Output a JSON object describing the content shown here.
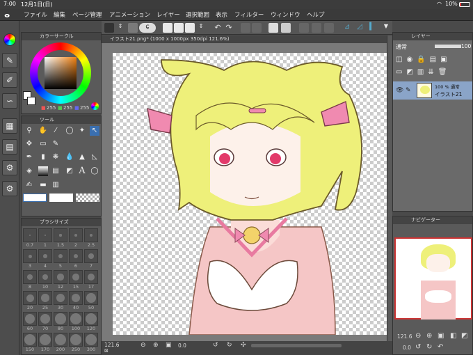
{
  "status": {
    "time": "7:00",
    "date": "12月1日(日)",
    "battery": "10%"
  },
  "menu": [
    "ファイル",
    "編集",
    "ページ管理",
    "アニメーション",
    "レイヤー",
    "選択範囲",
    "表示",
    "フィルター",
    "ウィンドウ",
    "ヘルプ"
  ],
  "document_tab": "イラスト21.png* (1000 x 1000px 350dpi 121.6%)",
  "color_panel": {
    "title": "カラーサークル",
    "r": "255",
    "g": "255",
    "b": "255"
  },
  "tool_panel": {
    "title": "ツール"
  },
  "brush_panel": {
    "title": "ブラシサイズ",
    "sizes": [
      "0.7",
      "1",
      "1.5",
      "2",
      "2.5",
      "3",
      "4",
      "5",
      "6",
      "7",
      "8",
      "10",
      "12",
      "15",
      "17",
      "20",
      "25",
      "30",
      "40",
      "50",
      "60",
      "70",
      "80",
      "100",
      "120",
      "150",
      "170",
      "200",
      "250",
      "300"
    ]
  },
  "layer_panel": {
    "title": "レイヤー",
    "blend_mode": "通常",
    "opacity": "100",
    "layer_opacity_label": "100 %  通常",
    "layer_name": "イラスト21"
  },
  "navigator": {
    "title": "ナビゲーター",
    "zoom": "121.6",
    "rotation": "0.0"
  },
  "bottom_bar": {
    "zoom": "121.6",
    "rotation": "0.0"
  }
}
